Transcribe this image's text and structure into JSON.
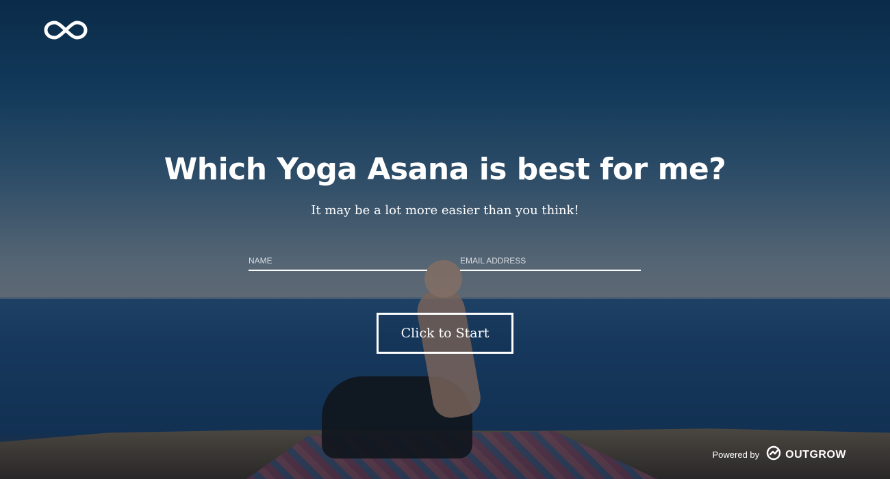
{
  "header": {
    "logo_icon": "infinity-icon"
  },
  "main": {
    "title": "Which Yoga Asana is best for me?",
    "subtitle": "It may be a lot more easier than you think!",
    "form": {
      "name_placeholder": "NAME",
      "email_placeholder": "EMAIL ADDRESS",
      "start_label": "Click to Start"
    }
  },
  "footer": {
    "powered_by": "Powered by",
    "brand_name": "OUTGROW",
    "brand_icon": "outgrow-logo-icon"
  },
  "colors": {
    "text": "#ffffff",
    "overlay": "#0a192d"
  }
}
